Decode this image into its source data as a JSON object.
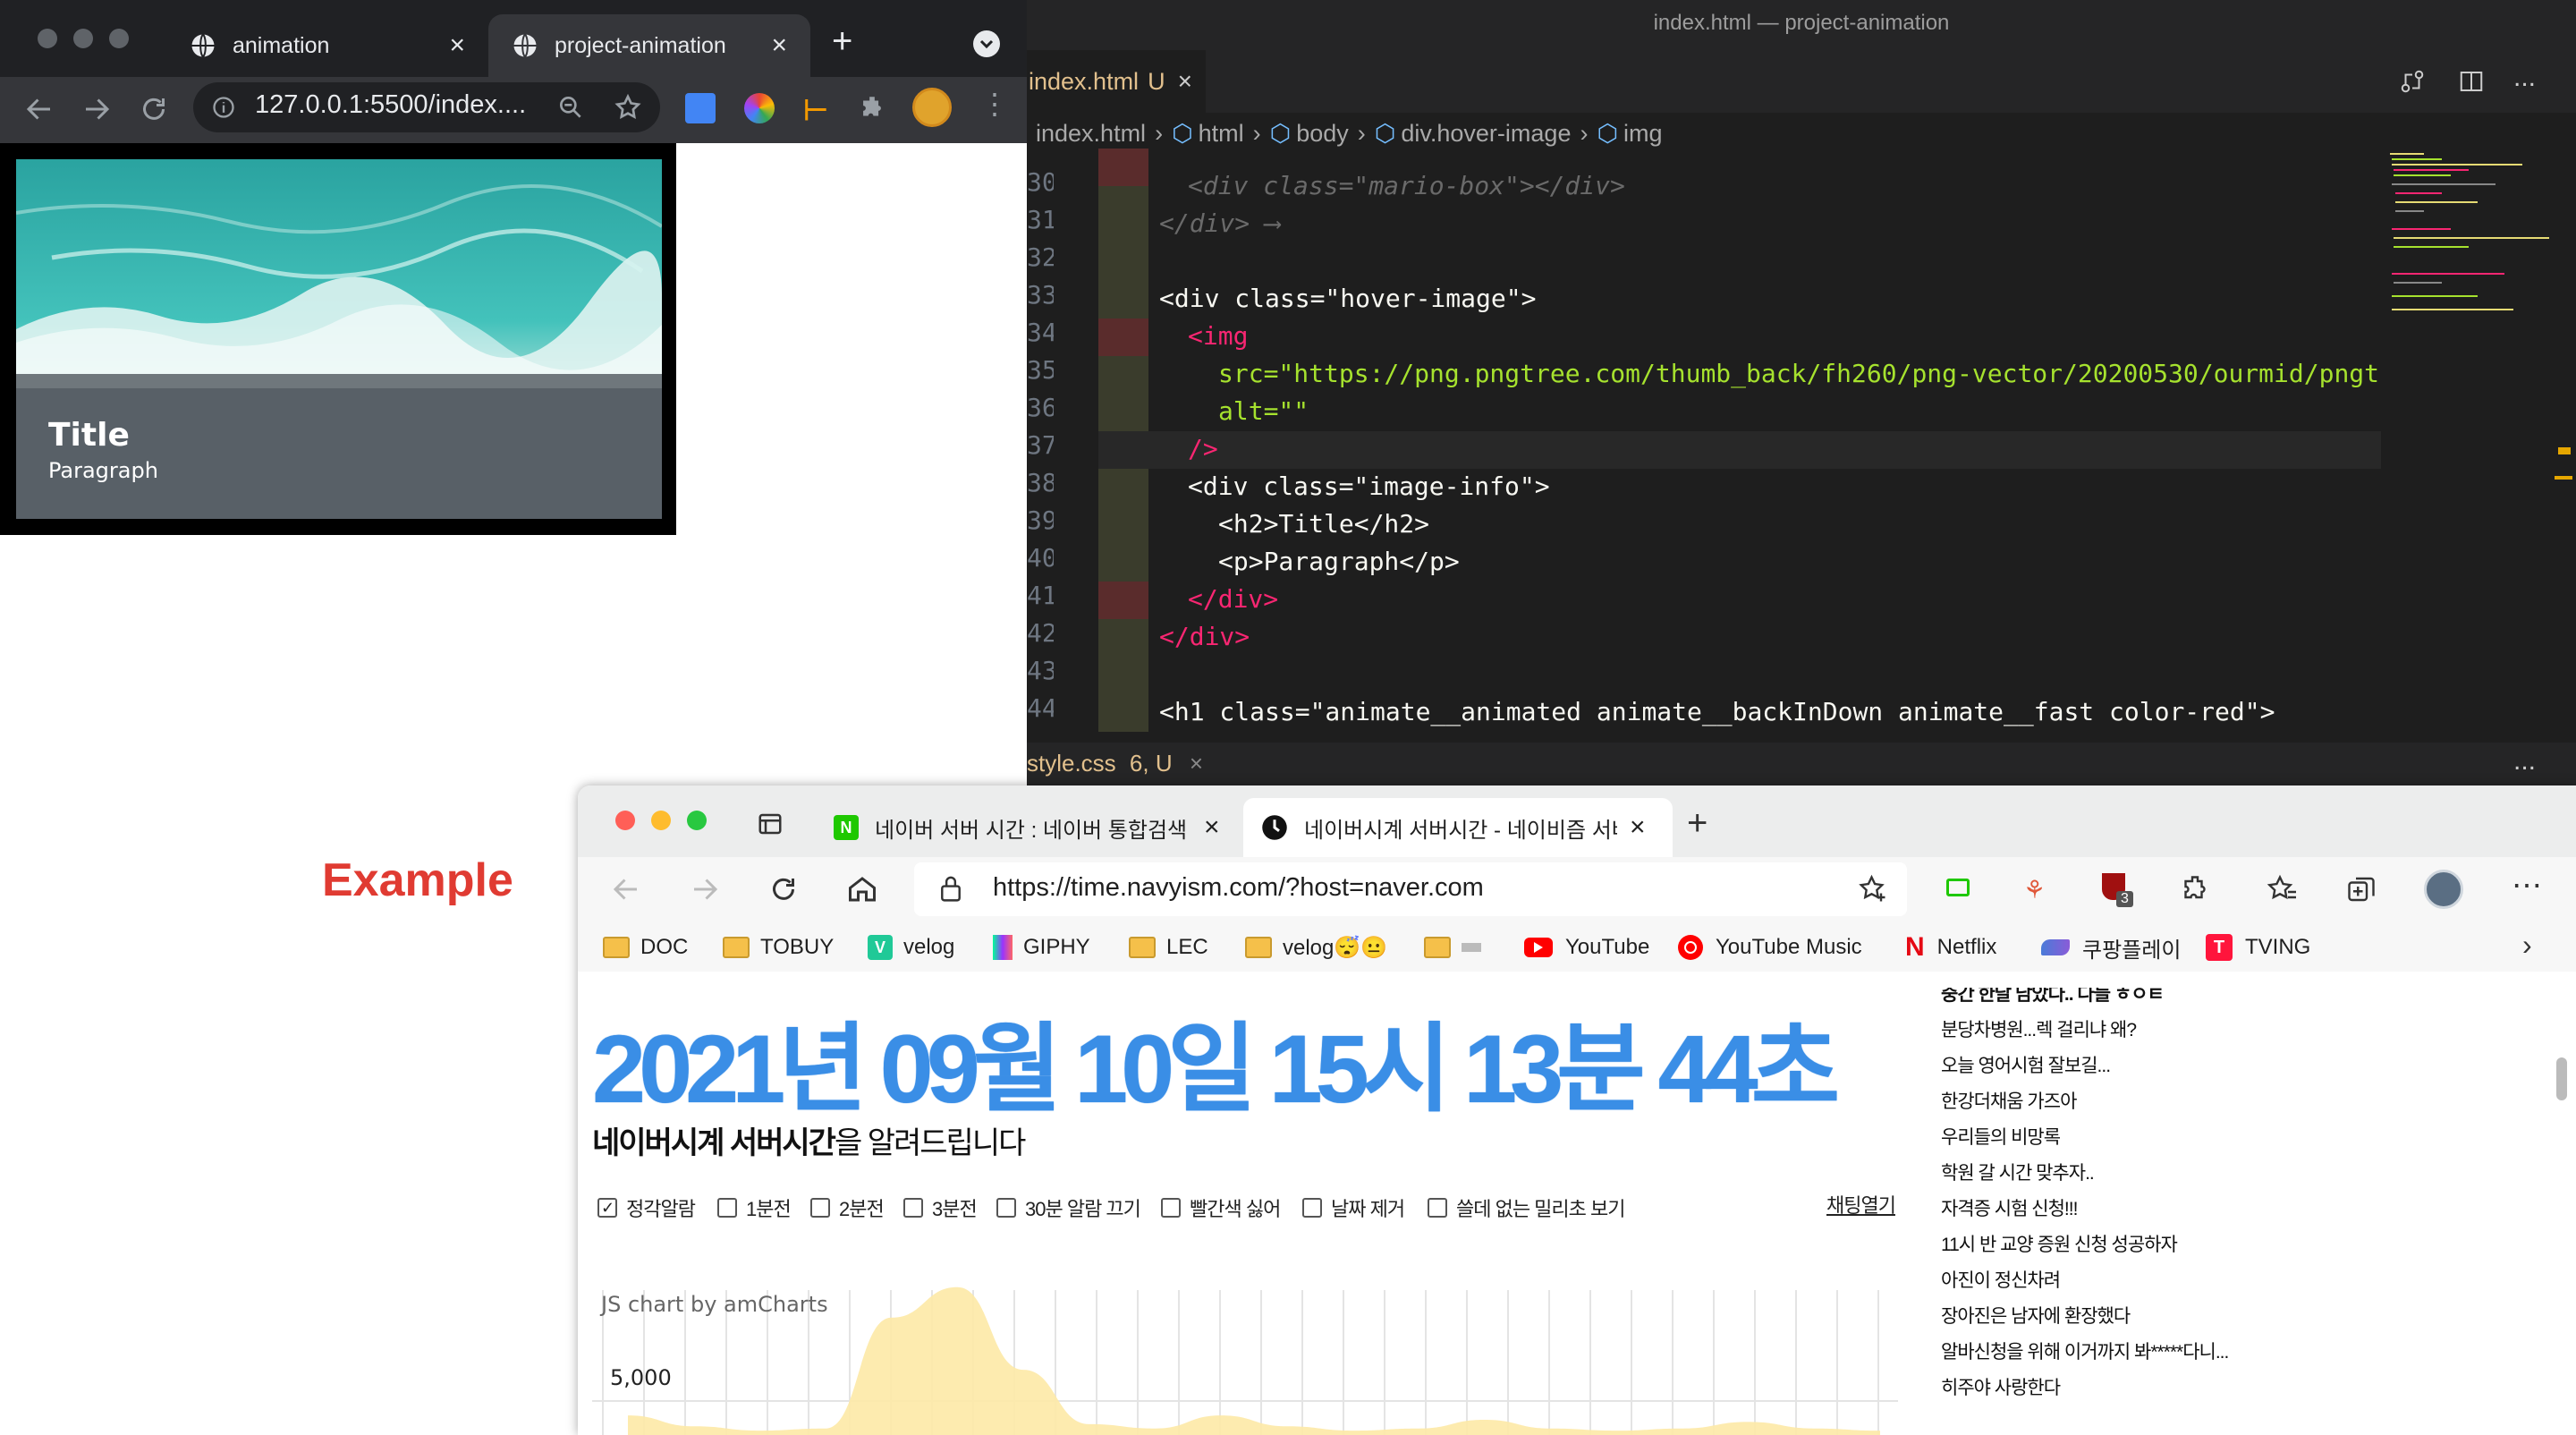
{
  "chrome": {
    "tabs": [
      {
        "label": "animation"
      },
      {
        "label": "project-animation"
      }
    ],
    "new_tab": "+",
    "close": "×",
    "url": "127.0.0.1:5500/index....",
    "card": {
      "title": "Title",
      "paragraph": "Paragraph"
    }
  },
  "vscode": {
    "window_title": "index.html — project-animation",
    "tab_label": "index.html",
    "tab_status": "U",
    "breadcrumb": [
      "index.html",
      "html",
      "body",
      "div.hover-image",
      "img"
    ],
    "lines": [
      {
        "n": "30",
        "text": "<div class=\"mario-box\"></div>"
      },
      {
        "n": "31",
        "text": "</div> ⟶"
      },
      {
        "n": "32",
        "text": ""
      },
      {
        "n": "33",
        "text": "<div class=\"hover-image\">"
      },
      {
        "n": "34",
        "text": "<img"
      },
      {
        "n": "35",
        "text": "src=\"https://png.pngtree.com/thumb_back/fh260/png-vector/20200530/ourmid/pngtr"
      },
      {
        "n": "36",
        "text": "alt=\"\""
      },
      {
        "n": "37",
        "text": "/>"
      },
      {
        "n": "38",
        "text": "<div class=\"image-info\">"
      },
      {
        "n": "39",
        "text": "<h2>Title</h2>"
      },
      {
        "n": "40",
        "text": "<p>Paragraph</p>"
      },
      {
        "n": "41",
        "text": "</div>"
      },
      {
        "n": "42",
        "text": "</div>"
      },
      {
        "n": "43",
        "text": ""
      },
      {
        "n": "44",
        "text": "<h1 class=\"animate__animated animate__backInDown animate__fast color-red\">"
      }
    ],
    "panel_label": "style.css",
    "panel_status": "6, U",
    "more": "..."
  },
  "edge": {
    "tabs": [
      {
        "label": "네이버 서버 시간 : 네이버 통합검색"
      },
      {
        "label": "네이버시계 서버시간 - 네이비즘 서버"
      }
    ],
    "url": "https://time.navyism.com/?host=naver.com",
    "bookmarks": [
      "DOC",
      "TOBUY",
      "velog",
      "GIPHY",
      "LEC",
      "velog😴😐",
      "",
      "YouTube",
      "YouTube Music",
      "Netflix",
      "쿠팡플레이",
      "TVING"
    ],
    "ext_badge": "3"
  },
  "page": {
    "big_time": "2021년 09월 10일 15시 13분 44초",
    "subhead_bold": "네이버시계 서버시간",
    "subhead_rest": "을 알려드립니다",
    "checkboxes": [
      {
        "label": "정각알람",
        "checked": true
      },
      {
        "label": "1분전",
        "checked": false
      },
      {
        "label": "2분전",
        "checked": false
      },
      {
        "label": "3분전",
        "checked": false
      },
      {
        "label": "30분 알람 끄기",
        "checked": false
      },
      {
        "label": "빨간색 싫어",
        "checked": false
      },
      {
        "label": "날짜 제거",
        "checked": false
      },
      {
        "label": "쓸데 없는 밀리초 보기",
        "checked": false
      }
    ],
    "chat_open": "채팅열기",
    "chart_credit": "JS chart by amCharts",
    "chat": [
      "중간 한달 남았다.. 다들 ㅎㅇㅌ",
      "분당차병원...렉 걸리냐 왜?",
      "오늘 영어시험 잘보길...",
      "한강더채움 가즈아",
      "우리들의 비망록",
      "학원 갈 시간 맞추자..",
      "자격증 시험 신청!!!",
      "11시 반 교양 증원 신청 성공하자",
      "아진이 정신차려",
      "장아진은 남자에 환장했다",
      "알바신청을 위해 이거까지 봐*****다니...",
      "히주야 사랑한다"
    ]
  },
  "annotation": {
    "example": "Example"
  },
  "chart_data": {
    "type": "area",
    "title": "",
    "xlabel": "",
    "ylabel": "",
    "ytick_labels": [
      "5,000"
    ],
    "x": [
      0,
      1,
      2,
      3,
      4,
      5,
      6,
      7,
      8,
      9,
      10,
      11,
      12,
      13,
      14,
      15,
      16,
      17,
      18,
      19
    ],
    "values": [
      900,
      400,
      200,
      300,
      5400,
      6800,
      3000,
      500,
      300,
      900,
      400,
      200,
      300,
      700,
      300,
      200,
      300,
      600,
      300,
      200
    ]
  },
  "colors": {
    "accent": "#3a8ee6",
    "example": "#e03b32",
    "chart_fill": "#fde9a6"
  }
}
